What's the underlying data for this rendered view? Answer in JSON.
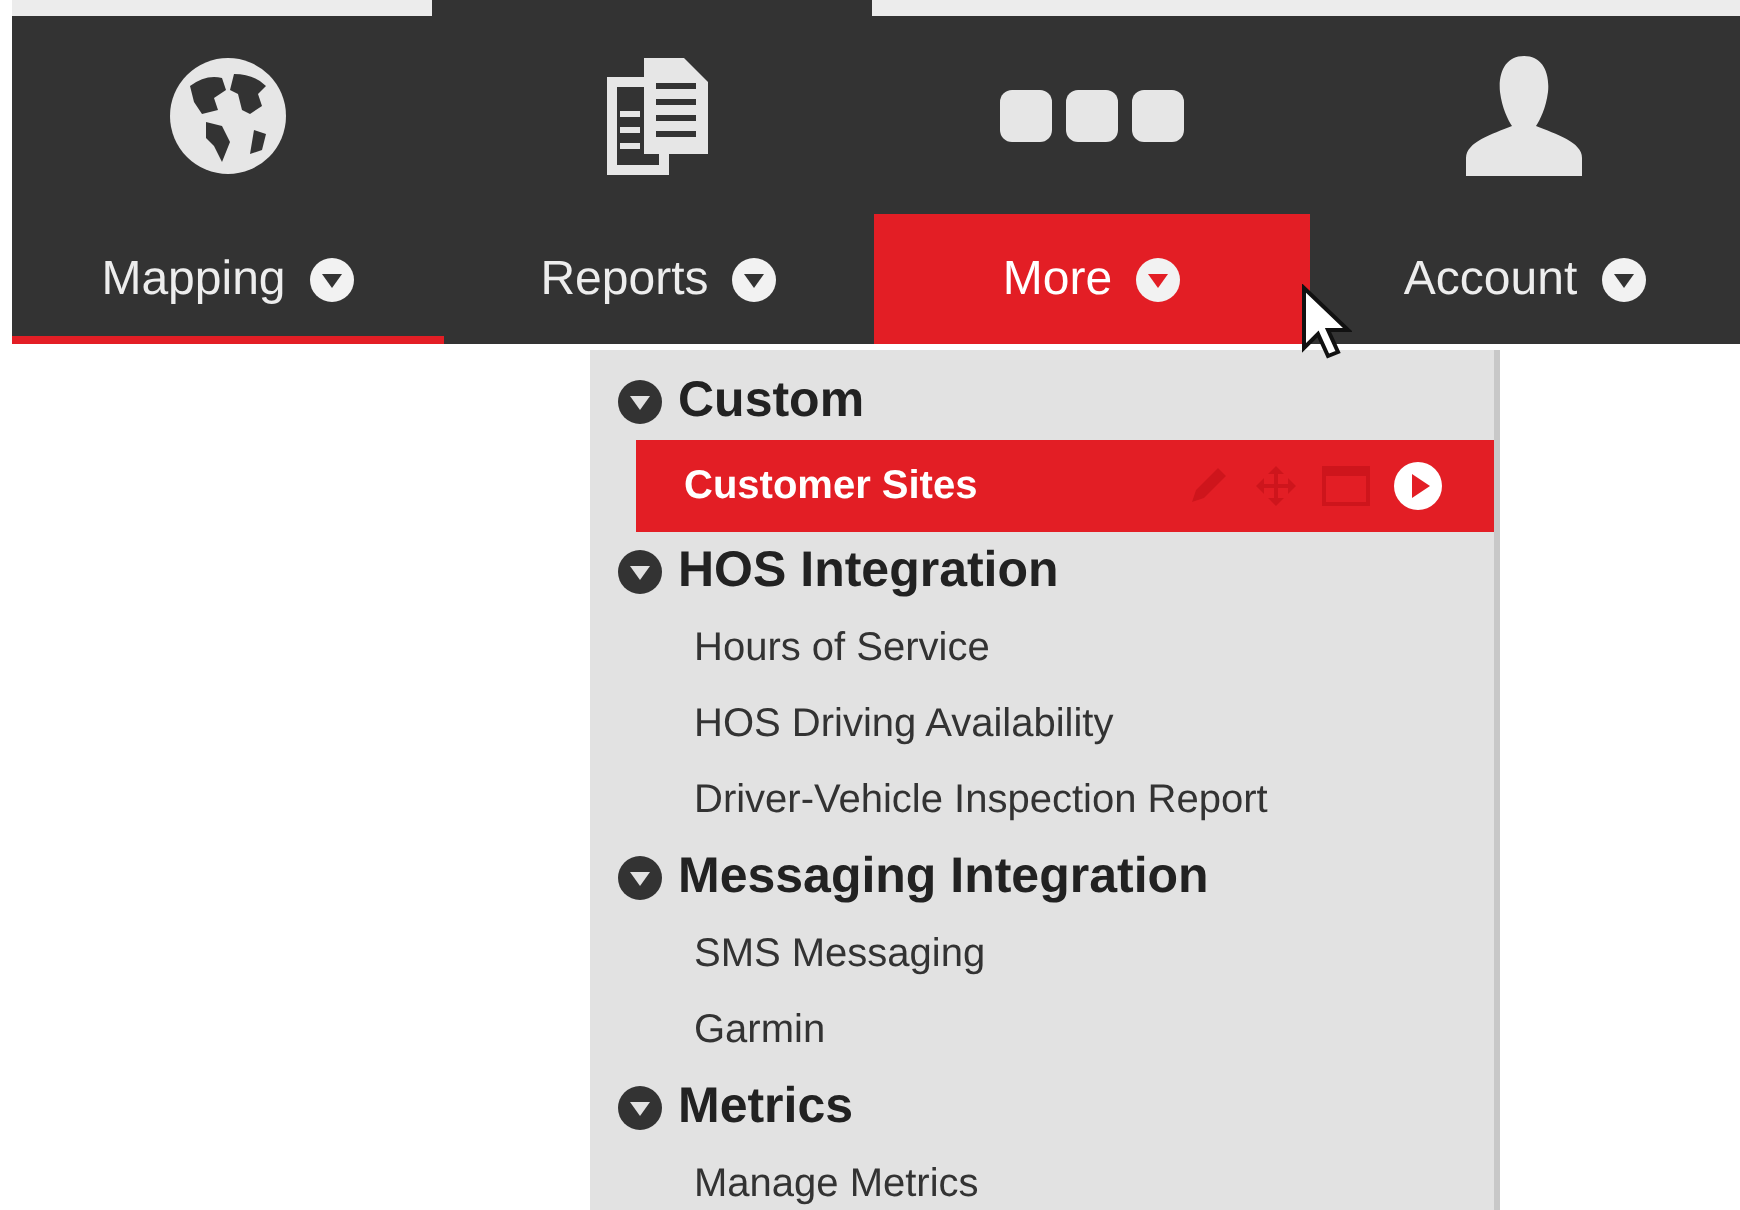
{
  "nav": [
    {
      "label": "Mapping",
      "kind": "globe",
      "selected": false,
      "current": true
    },
    {
      "label": "Reports",
      "kind": "reports",
      "selected": false,
      "current": false
    },
    {
      "label": "More",
      "kind": "more",
      "selected": true,
      "current": false
    },
    {
      "label": "Account",
      "kind": "person",
      "selected": false,
      "current": false
    }
  ],
  "menu": [
    {
      "label": "Custom",
      "expanded": true,
      "children": [
        {
          "label": "Customer Sites",
          "selected": true
        }
      ]
    },
    {
      "label": "HOS Integration",
      "expanded": true,
      "children": [
        {
          "label": "Hours of Service",
          "selected": false
        },
        {
          "label": "HOS Driving Availability",
          "selected": false
        },
        {
          "label": "Driver-Vehicle Inspection Report",
          "selected": false
        }
      ]
    },
    {
      "label": "Messaging Integration",
      "expanded": true,
      "children": [
        {
          "label": "SMS Messaging",
          "selected": false
        },
        {
          "label": "Garmin",
          "selected": false
        }
      ]
    },
    {
      "label": "Metrics",
      "expanded": true,
      "children": [
        {
          "label": "Manage Metrics",
          "selected": false
        }
      ]
    }
  ]
}
